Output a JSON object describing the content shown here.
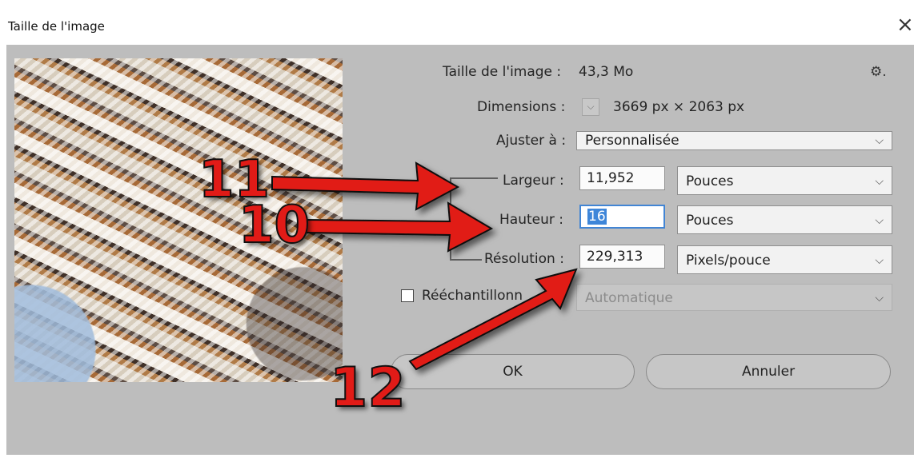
{
  "window": {
    "title": "Taille de l'image",
    "close_symbol": "×"
  },
  "info": {
    "size_label": "Taille de l'image :",
    "size_value": "43,3 Mo",
    "dims_label": "Dimensions :",
    "dims_value": "3669 px  ×  2063 px",
    "fit_label": "Ajuster à :",
    "fit_value": "Personnalisée"
  },
  "fields": {
    "width_label": "Largeur :",
    "width_value": "11,952",
    "width_unit": "Pouces",
    "height_label": "Hauteur :",
    "height_value": "16",
    "height_unit": "Pouces",
    "resolution_label": "Résolution :",
    "resolution_value": "229,313",
    "resolution_unit": "Pixels/pouce"
  },
  "resample": {
    "label": "Rééchantillonn",
    "method": "Automatique",
    "checked": false
  },
  "buttons": {
    "ok": "OK",
    "cancel": "Annuler"
  },
  "icons": {
    "gear": "⚙.",
    "chevron": "⌵",
    "checkmark": "✓"
  },
  "annotations": {
    "a": "11",
    "b": "10",
    "c": "12"
  },
  "colors": {
    "arrow": "#e11b17",
    "highlight": "#3e86d9",
    "panel": "#bdbdbd"
  }
}
